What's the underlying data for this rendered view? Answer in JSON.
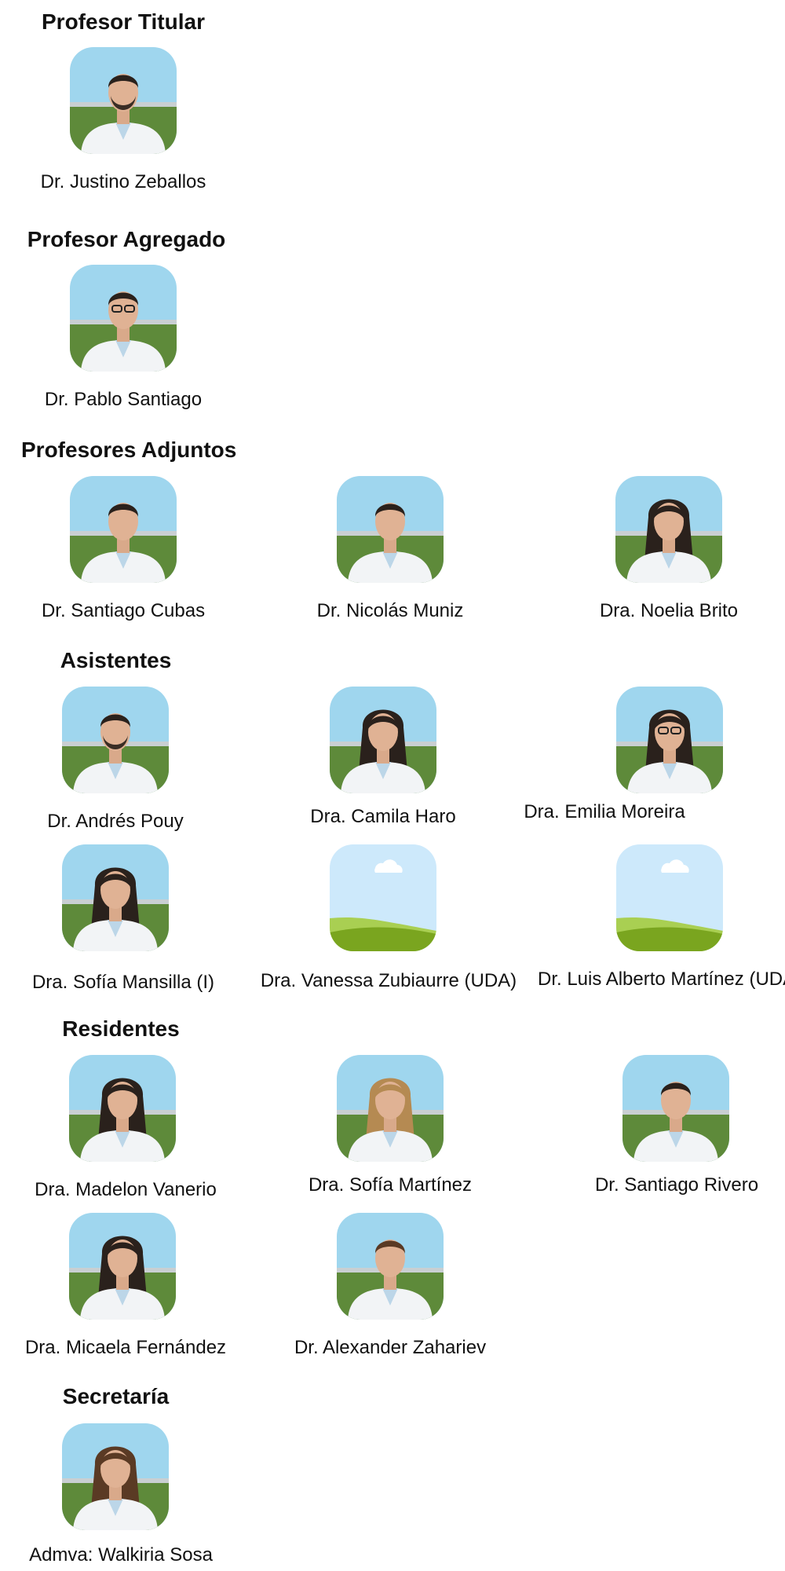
{
  "sections": {
    "titular": {
      "title": "Profesor Titular",
      "members": [
        {
          "name": "Dr. Justino Zeballos",
          "photo": "portrait-man-beard-dark-hair"
        }
      ]
    },
    "agregado": {
      "title": "Profesor Agregado",
      "members": [
        {
          "name": "Dr. Pablo Santiago",
          "photo": "portrait-man-glasses"
        }
      ]
    },
    "adjuntos": {
      "title": "Profesores Adjuntos",
      "members": [
        {
          "name": "Dr. Santiago Cubas",
          "photo": "portrait-man-short-hair"
        },
        {
          "name": "Dr. Nicolás Muniz",
          "photo": "portrait-man-dark-hair"
        },
        {
          "name": "Dra. Noelia Brito",
          "photo": "portrait-woman-dark-hair"
        }
      ]
    },
    "asistentes": {
      "title": "Asistentes",
      "members": [
        {
          "name": "Dr. Andrés Pouy",
          "photo": "portrait-man-beard"
        },
        {
          "name": "Dra. Camila Haro",
          "photo": "portrait-woman-curly-hair"
        },
        {
          "name": "Dra. Emilia Moreira",
          "photo": "portrait-woman-glasses"
        },
        {
          "name": "Dra. Sofía Mansilla (I)",
          "photo": "portrait-woman-long-hair"
        },
        {
          "name": "Dra. Vanessa Zubiaurre (UDA)",
          "photo": "placeholder-landscape-icon"
        },
        {
          "name": "Dr. Luis Alberto Martínez (UDA)",
          "photo": "placeholder-landscape-icon"
        }
      ]
    },
    "residentes": {
      "title": "Residentes",
      "members": [
        {
          "name": "Dra. Madelon Vanerio",
          "photo": "portrait-woman-long-dark-hair"
        },
        {
          "name": "Dra. Sofía Martínez",
          "photo": "portrait-woman-curly-blonde-hair"
        },
        {
          "name": "Dr. Santiago Rivero",
          "photo": "portrait-man-dark-hair"
        },
        {
          "name": "Dra. Micaela Fernández",
          "photo": "portrait-woman-dark-hair"
        },
        {
          "name": "Dr. Alexander Zahariev",
          "photo": "portrait-man-brown-hair"
        }
      ]
    },
    "secretaria": {
      "title": "Secretaría",
      "members": [
        {
          "name": "Admva: Walkiria Sosa",
          "photo": "portrait-woman-brown-hair"
        }
      ]
    }
  },
  "colors": {
    "text": "#111111",
    "sky": "#9fd6ee",
    "trees": "#5e8a3a",
    "coat": "#f2f4f6",
    "placeholder_sky": "#cde9fb",
    "placeholder_hill_light": "#a9cf52",
    "placeholder_hill_dark": "#7aa51f"
  }
}
